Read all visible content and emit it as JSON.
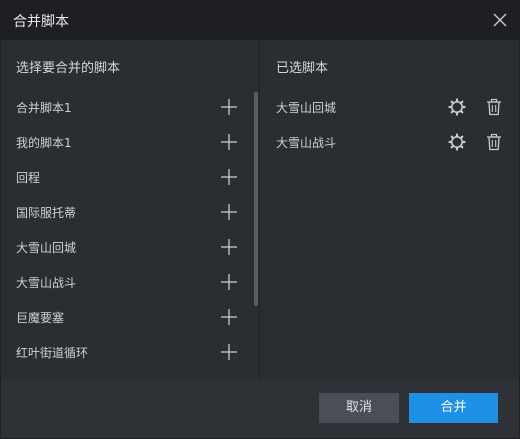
{
  "dialog": {
    "title": "合并脚本",
    "close_icon": "close-icon"
  },
  "left": {
    "header": "选择要合并的脚本",
    "items": [
      {
        "label": "合并脚本1",
        "icon": "plus-icon"
      },
      {
        "label": "我的脚本1",
        "icon": "plus-icon"
      },
      {
        "label": "回程",
        "icon": "plus-icon"
      },
      {
        "label": "国际服托蒂",
        "icon": "plus-icon"
      },
      {
        "label": "大雪山回城",
        "icon": "plus-icon"
      },
      {
        "label": "大雪山战斗",
        "icon": "plus-icon"
      },
      {
        "label": "巨魔要塞",
        "icon": "plus-icon"
      },
      {
        "label": "红叶街道循环",
        "icon": "plus-icon"
      }
    ]
  },
  "right": {
    "header": "已选脚本",
    "items": [
      {
        "label": "大雪山回城",
        "icons": [
          "gear-icon",
          "trash-icon"
        ]
      },
      {
        "label": "大雪山战斗",
        "icons": [
          "gear-icon",
          "trash-icon"
        ]
      }
    ]
  },
  "footer": {
    "cancel_label": "取消",
    "merge_label": "合并"
  },
  "colors": {
    "titlebar": "#1d1f23",
    "panel": "#2a2d32",
    "footer": "#2e3136",
    "accent": "#1e90e6",
    "cancel": "#4a4e56"
  }
}
